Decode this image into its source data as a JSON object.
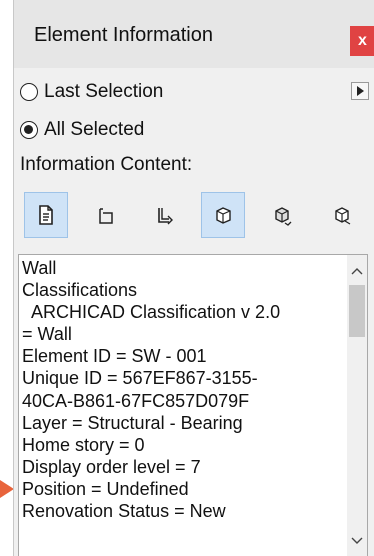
{
  "window": {
    "title": "Element Information",
    "close_label": "x"
  },
  "selection": {
    "options": [
      {
        "label": "Last Selection",
        "checked": false
      },
      {
        "label": "All Selected",
        "checked": true
      }
    ]
  },
  "info_content": {
    "label": "Information Content:",
    "buttons": [
      {
        "icon": "document-icon",
        "active": true
      },
      {
        "icon": "corner-frame-icon",
        "active": false
      },
      {
        "icon": "wall-profile-icon",
        "active": false
      },
      {
        "icon": "cube-icon",
        "active": true
      },
      {
        "icon": "cube-rotate-icon",
        "active": false
      },
      {
        "icon": "cube-outline-icon",
        "active": false
      }
    ]
  },
  "details": {
    "lines": [
      "Wall",
      "Classifications",
      "  ARCHICAD Classification v 2.0",
      "= Wall",
      "Element ID = SW - 001",
      "Unique ID = 567EF867-3155-",
      "40CA-B861-67FC857D079F",
      "Layer = Structural - Bearing",
      "Home story = 0",
      "Display order level = 7",
      "Position = Undefined",
      "Renovation Status = New"
    ]
  },
  "colors": {
    "accent_active": "#cfe3f7",
    "close_red": "#e04343",
    "pointer_arrow": "#e8643c"
  }
}
